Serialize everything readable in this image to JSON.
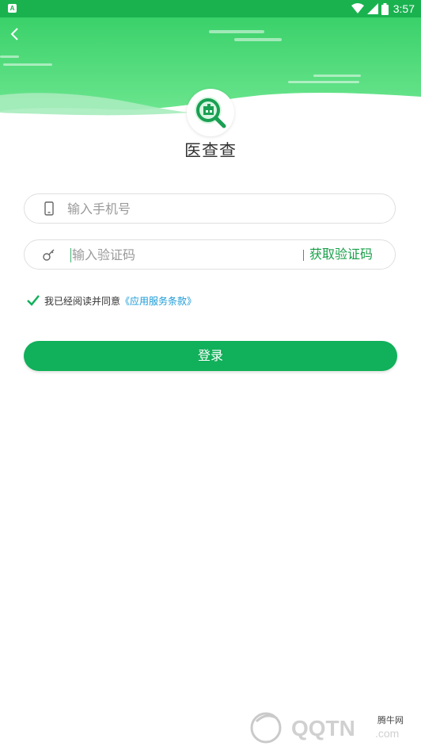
{
  "status_bar": {
    "notification_icon": "A",
    "time": "3:57",
    "icons": [
      "wifi-icon",
      "signal-icon",
      "battery-icon"
    ]
  },
  "header": {
    "back_icon": "chevron-left-icon",
    "app_name": "医查查",
    "logo_icon": "magnifier-hospital-icon"
  },
  "form": {
    "phone_placeholder": "输入手机号",
    "phone_icon": "phone-icon",
    "code_placeholder": "输入验证码",
    "code_icon": "key-icon",
    "get_code_label": "获取验证码",
    "agreement_text": "我已经阅读并同意",
    "agreement_link": "《应用服务条款》",
    "agreement_checked": true,
    "login_label": "登录"
  },
  "watermark": {
    "small": "腾牛网",
    "brand": "QQTN",
    "suffix": ".com"
  },
  "colors": {
    "primary": "#11b05a",
    "header_green": "#19b24f",
    "link_blue": "#1a9bd7"
  }
}
